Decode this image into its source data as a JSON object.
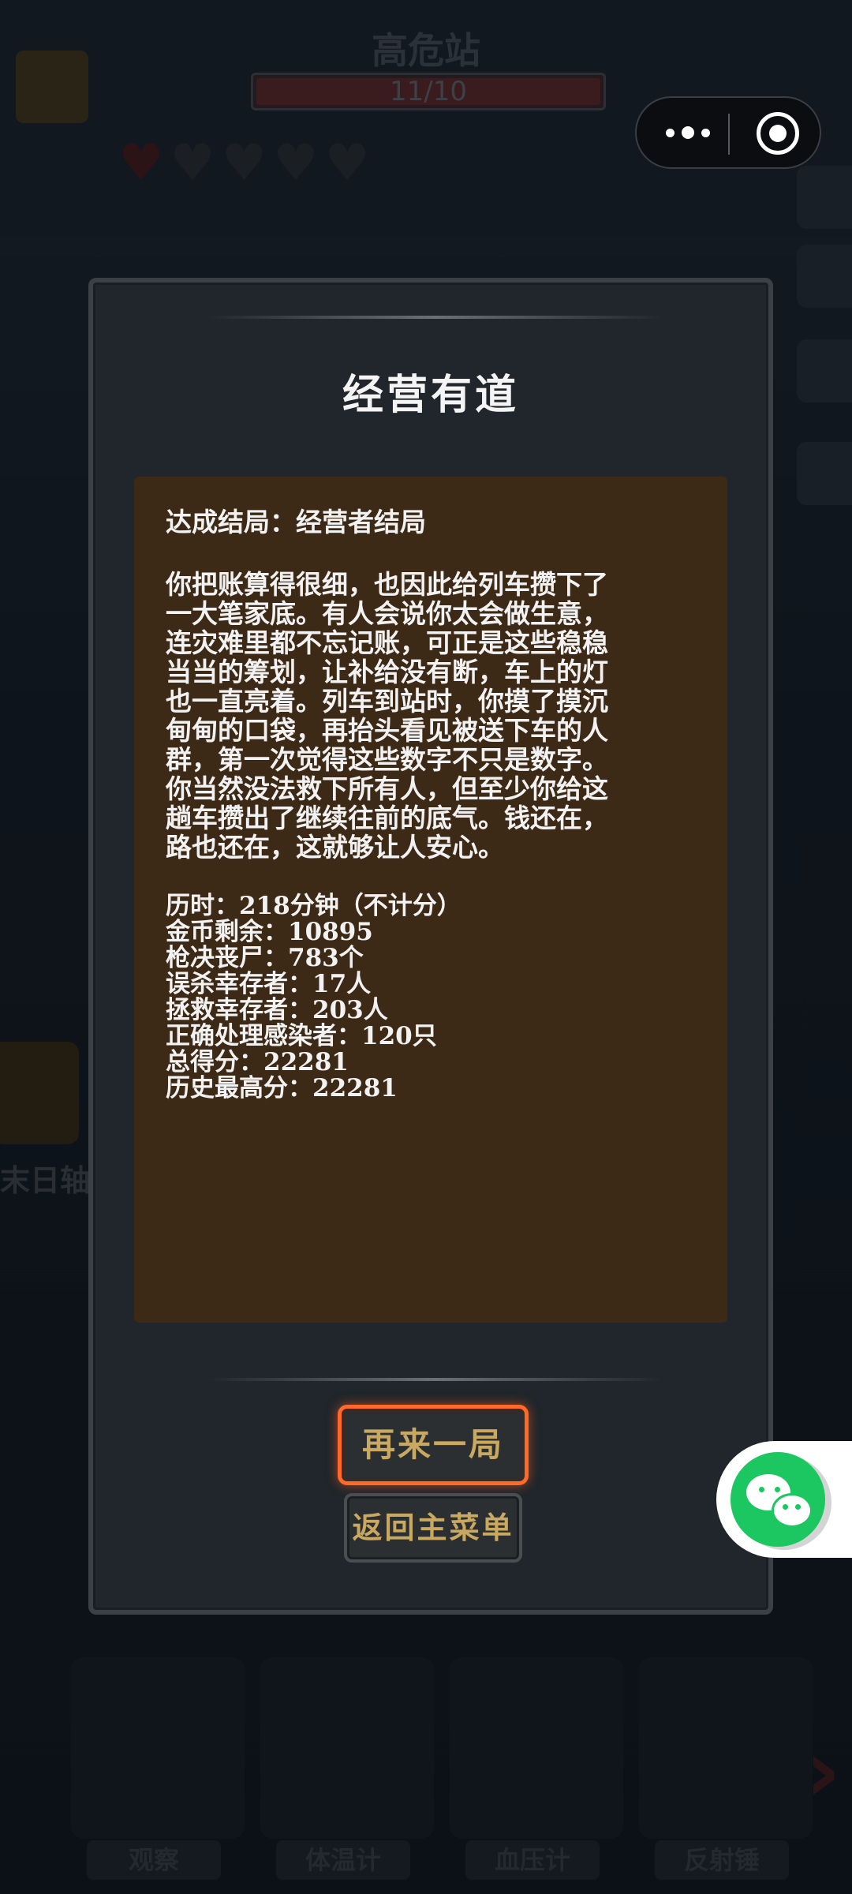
{
  "background": {
    "station_title": "高危站",
    "progress_text": "11/10",
    "left_label": "末日轴",
    "tools": [
      "观察",
      "体温计",
      "血压计",
      "反射锤"
    ]
  },
  "dialog": {
    "title": "经营有道",
    "ending": "达成结局：经营者结局",
    "story_lines": [
      "你把账算得很细，也因此给列车攒下了",
      "一大笔家底。有人会说你太会做生意，",
      "连灾难里都不忘记账，可正是这些稳稳",
      "当当的筹划，让补给没有断，车上的灯",
      "也一直亮着。列车到站时，你摸了摸沉",
      "甸甸的口袋，再抬头看见被送下车的人",
      "群，第一次觉得这些数字不只是数字。",
      "你当然没法救下所有人，但至少你给这",
      "趟车攒出了继续往前的底气。钱还在，",
      "路也还在，这就够让人安心。"
    ],
    "stats": [
      "历时：218分钟（不计分）",
      "金币剩余：10895",
      "枪决丧尸：783个",
      "误杀幸存者：17人",
      "拯救幸存者：203人",
      "正确处理感染者：120只",
      "总得分：22281",
      "历史最高分：22281"
    ],
    "buttons": {
      "again": "再来一局",
      "menu": "返回主菜单"
    }
  },
  "colors": {
    "accent_orange": "#ff6a2a",
    "story_bg": "#3d2a16",
    "button_text": "#c9a860",
    "wechat_green": "#1cc660"
  },
  "icons": [
    "more-dots-icon",
    "close-target-icon",
    "wechat-icon"
  ]
}
